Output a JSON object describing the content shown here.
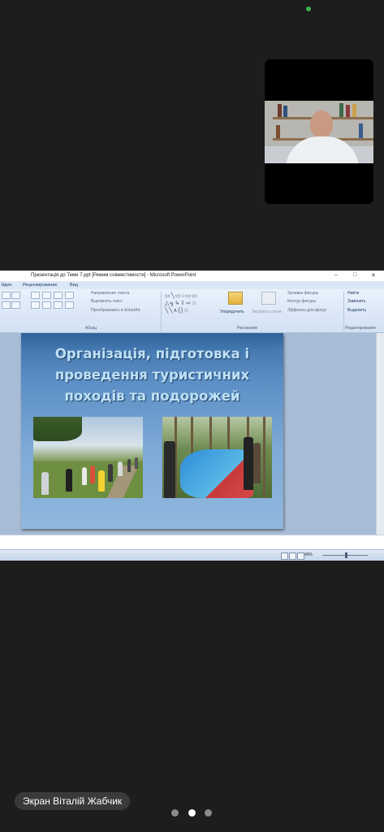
{
  "participant_name": "Экран Віталій Жабчик",
  "window": {
    "title": "Презентація до Теми 7.ppt [Режим совместимости] - Microsoft PowerPoint",
    "controls": [
      "–",
      "□",
      "✕"
    ]
  },
  "ribbon": {
    "tabs": [
      "йдое",
      "Рецензирование",
      "Вид"
    ],
    "paragraph_items": [
      "Направление текста",
      "Выровнять текст",
      "Преобразовать в SmartArt"
    ],
    "groups": [
      "Абзац",
      "Рисование",
      "Редактирование"
    ],
    "arrange_label": "Упорядочить",
    "quick_styles_label": "Экспресс-стили",
    "drawing_items": [
      "Заливка фигуры",
      "Контур фигуры",
      "Эффекты для фигур"
    ],
    "editing_items": [
      "Найти",
      "Заменить",
      "Выделить"
    ]
  },
  "slide": {
    "title_lines": [
      "Організація, підготовка і",
      "проведення туристичних",
      "походів та подорожей"
    ]
  },
  "status": {
    "zoom": "49%"
  },
  "pager": {
    "count": 3,
    "active_index": 1
  },
  "colors": {
    "background": "#1d1d1d",
    "speaking_indicator": "#3bb54a",
    "slide_title": "#bfe1f5"
  }
}
